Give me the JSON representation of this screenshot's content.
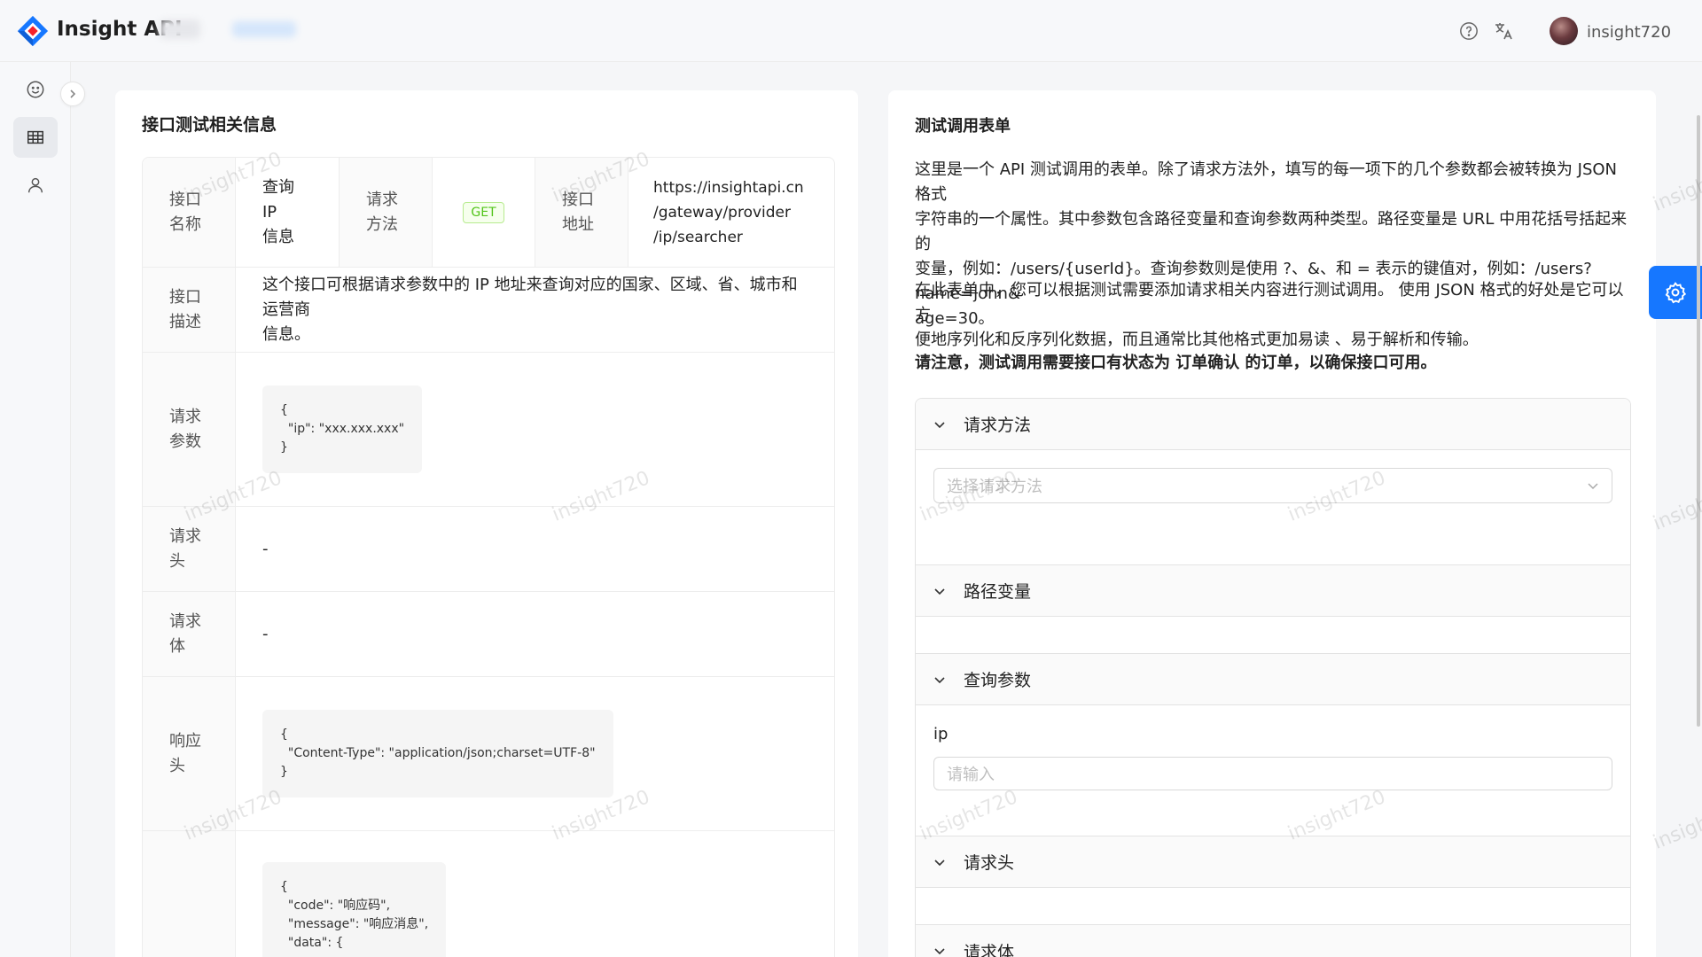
{
  "app": {
    "title": "Insight API",
    "username": "insight720"
  },
  "header": {
    "help_icon": "question-circle-icon",
    "translate_icon": "translate-icon"
  },
  "sidebar": {
    "items": [
      {
        "icon": "smile-icon"
      },
      {
        "icon": "table-icon",
        "active": true
      },
      {
        "icon": "user-icon"
      }
    ],
    "collapse_icon": "chevron-right-icon"
  },
  "left": {
    "title": "接口测试相关信息",
    "labels": {
      "name": [
        "接口",
        "名称"
      ],
      "method": [
        "请求",
        "方法"
      ],
      "address": [
        "接口",
        "地址"
      ],
      "desc": [
        "接口",
        "描述"
      ],
      "params": [
        "请求",
        "参数"
      ],
      "req_headers": [
        "请求",
        "头"
      ],
      "req_body": [
        "请求",
        "体"
      ],
      "resp_headers": [
        "响应",
        "头"
      ]
    },
    "name_value": [
      "查询 IP",
      "信息"
    ],
    "method_value": "GET",
    "address_value": [
      "https://insightapi.cn",
      "/gateway/provider",
      "/ip/searcher"
    ],
    "desc_value": [
      "这个接口可根据请求参数中的 IP 地址来查询对应的国家、区域、省、城市和运营商",
      "信息。"
    ],
    "params_code": "{\n  \"ip\": \"xxx.xxx.xxx\"\n}",
    "req_headers_value": "-",
    "req_body_value": "-",
    "resp_headers_code": "{\n  \"Content-Type\": \"application/json;charset=UTF-8\"\n}",
    "resp_body_code": "{\n  \"code\": \"响应码\",\n  \"message\": \"响应消息\",\n  \"data\": {"
  },
  "right": {
    "title": "测试调用表单",
    "para1": [
      "这里是一个 API 测试调用的表单。除了请求方法外，填写的每一项下的几个参数都会被转换为 JSON 格式",
      "字符串的一个属性。其中参数包含路径变量和查询参数两种类型。路径变量是 URL 中用花括号括起来的",
      "变量，例如：/users/{userId}。查询参数则是使用 ?、&、和 = 表示的键值对，例如：/users?name=john&",
      "age=30。"
    ],
    "para2": [
      "在此表单中，您可以根据测试需要添加请求相关内容进行测试调用。 使用 JSON 格式的好处是它可以方",
      "便地序列化和反序列化数据，而且通常比其他格式更加易读 、易于解析和传输。"
    ],
    "notice": "请注意，测试调用需要接口有状态为 订单确认 的订单，以确保接口可用。",
    "panels": {
      "method": "请求方法",
      "path_vars": "路径变量",
      "query": "查询参数",
      "headers": "请求头",
      "body": "请求体"
    },
    "method_placeholder": "选择请求方法",
    "query_field_label": "ip",
    "query_field_placeholder": "请输入"
  },
  "watermark": "insight720",
  "colors": {
    "primary": "#1677ff",
    "success": "#52c41a"
  }
}
